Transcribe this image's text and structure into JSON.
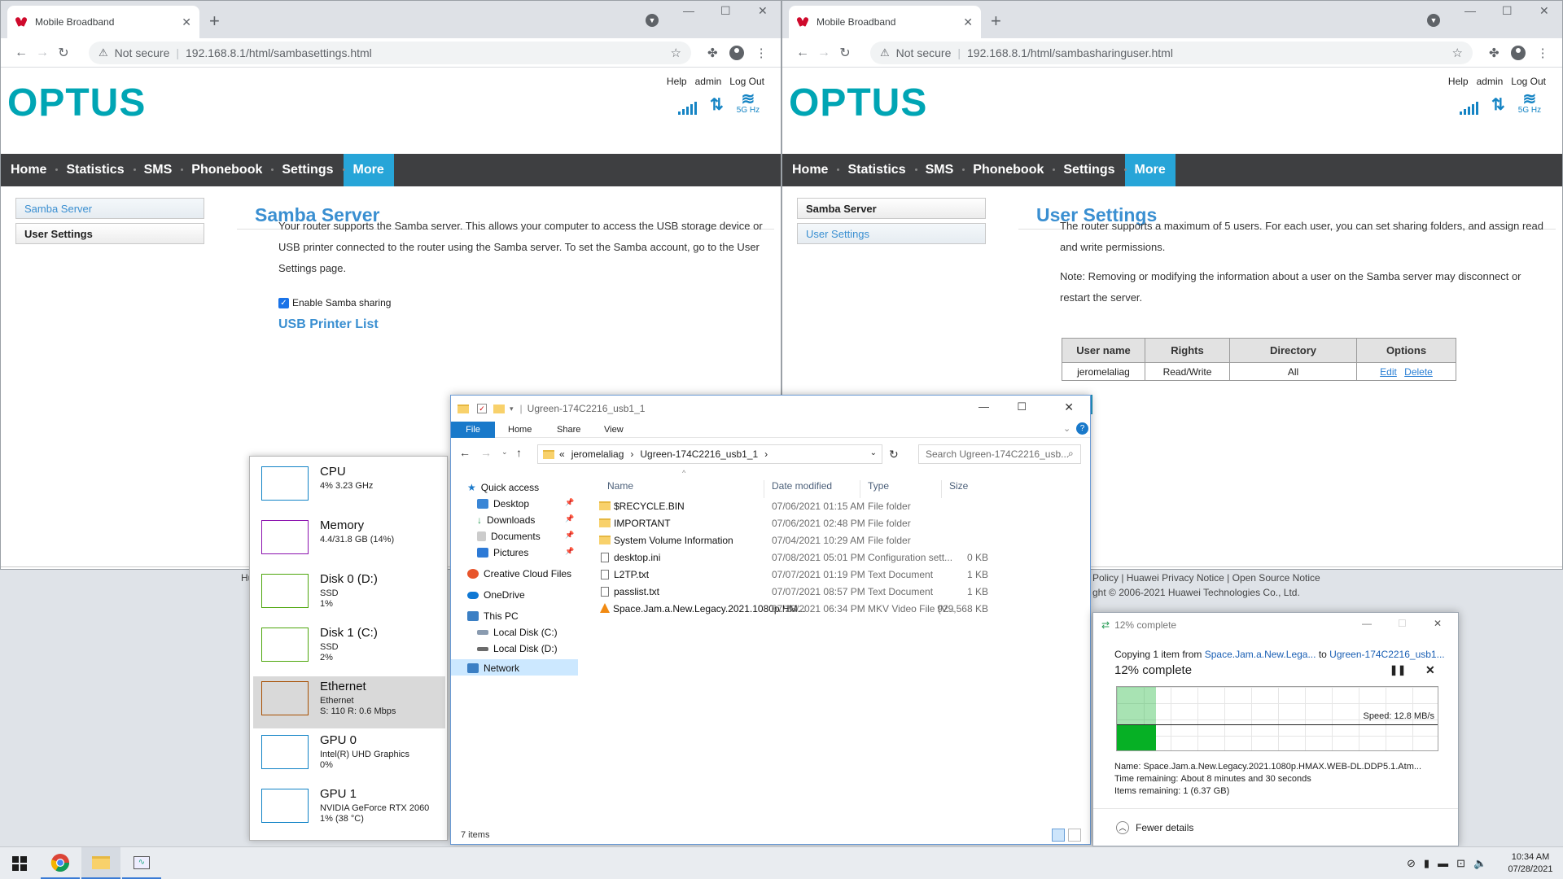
{
  "left_browser": {
    "tab_title": "Mobile Broadband",
    "security": "Not secure",
    "url": "192.168.8.1/html/sambasettings.html",
    "top_links": [
      "Help",
      "admin",
      "Log Out"
    ],
    "logo": "OPTUS",
    "wifi_label": "5G Hz",
    "nav": [
      "Home",
      "Statistics",
      "SMS",
      "Phonebook",
      "Settings",
      "More"
    ],
    "active_nav": "More",
    "sidebar": [
      "Samba Server",
      "User Settings"
    ],
    "page_title": "Samba Server",
    "description": "Your router supports the Samba server. This allows your computer to access the USB storage device or USB printer connected to the router using the Samba server. To set the Samba account, go to the User Settings page.",
    "checkbox_label": "Enable Samba sharing",
    "checkbox_checked": true,
    "link": "USB Printer List",
    "footer_fragment": "Hu"
  },
  "right_browser": {
    "tab_title": "Mobile Broadband",
    "security": "Not secure",
    "url": "192.168.8.1/html/sambasharinguser.html",
    "top_links": [
      "Help",
      "admin",
      "Log Out"
    ],
    "logo": "OPTUS",
    "wifi_label": "5G Hz",
    "nav": [
      "Home",
      "Statistics",
      "SMS",
      "Phonebook",
      "Settings",
      "More"
    ],
    "sidebar": [
      "Samba Server",
      "User Settings"
    ],
    "page_title": "User Settings",
    "paragraph1": "The router supports a maximum of 5 users. For each user, you can set sharing folders, and assign read and write permissions.",
    "paragraph2": "Note: Removing or modifying the information about a user on the Samba server may disconnect or restart the server.",
    "table": {
      "headers": [
        "User name",
        "Rights",
        "Directory",
        "Options"
      ],
      "rows": [
        {
          "user": "jeromelaliag",
          "rights": "Read/Write",
          "directory": "All",
          "edit": "Edit",
          "delete": "Delete"
        }
      ]
    },
    "footer_links": "Policy | Huawei Privacy Notice | Open Source Notice",
    "copyright": "ght © 2006-2021 Huawei Technologies Co., Ltd."
  },
  "task_manager": {
    "items": [
      {
        "name": "CPU",
        "sub1": "4% 3.23 GHz",
        "sub2": "",
        "color": "#1183c6"
      },
      {
        "name": "Memory",
        "sub1": "4.4/31.8 GB (14%)",
        "sub2": "",
        "color": "#8b12ae"
      },
      {
        "name": "Disk 0 (D:)",
        "sub1": "SSD",
        "sub2": "1%",
        "color": "#4da60c"
      },
      {
        "name": "Disk 1 (C:)",
        "sub1": "SSD",
        "sub2": "2%",
        "color": "#4da60c"
      },
      {
        "name": "Ethernet",
        "sub1": "Ethernet",
        "sub2": "S: 110 R: 0.6 Mbps",
        "color": "#a74f01"
      },
      {
        "name": "GPU 0",
        "sub1": "Intel(R) UHD Graphics",
        "sub2": "0%",
        "color": "#1183c6"
      },
      {
        "name": "GPU 1",
        "sub1": "NVIDIA GeForce RTX 2060",
        "sub2": "1% (38 °C)",
        "color": "#1183c6"
      }
    ],
    "selected": "Ethernet"
  },
  "explorer": {
    "title": "Ugreen-174C2216_usb1_1",
    "ribbon": [
      "File",
      "Home",
      "Share",
      "View"
    ],
    "path": [
      "«",
      "jeromelaliag",
      "›",
      "Ugreen-174C2216_usb1_1",
      "›"
    ],
    "search_placeholder": "Search Ugreen-174C2216_usb...",
    "nav": {
      "quick_access": "Quick access",
      "desktop": "Desktop",
      "downloads": "Downloads",
      "documents": "Documents",
      "pictures": "Pictures",
      "ccf": "Creative Cloud Files",
      "onedrive": "OneDrive",
      "thispc": "This PC",
      "localc": "Local Disk (C:)",
      "locald": "Local Disk (D:)",
      "network": "Network"
    },
    "columns": [
      "Name",
      "Date modified",
      "Type",
      "Size"
    ],
    "files": [
      {
        "name": "$RECYCLE.BIN",
        "date": "07/06/2021 01:15 AM",
        "type": "File folder",
        "size": "",
        "icon": "folder"
      },
      {
        "name": "IMPORTANT",
        "date": "07/06/2021 02:48 PM",
        "type": "File folder",
        "size": "",
        "icon": "folder"
      },
      {
        "name": "System Volume Information",
        "date": "07/04/2021 10:29 AM",
        "type": "File folder",
        "size": "",
        "icon": "folder"
      },
      {
        "name": "desktop.ini",
        "date": "07/08/2021 05:01 PM",
        "type": "Configuration sett...",
        "size": "0 KB",
        "icon": "doc"
      },
      {
        "name": "L2TP.txt",
        "date": "07/07/2021 01:19 PM",
        "type": "Text Document",
        "size": "1 KB",
        "icon": "doc"
      },
      {
        "name": "passlist.txt",
        "date": "07/07/2021 08:57 PM",
        "type": "Text Document",
        "size": "1 KB",
        "icon": "doc"
      },
      {
        "name": "Space.Jam.a.New.Legacy.2021.1080p.HM...",
        "date": "07/28/2021 06:34 PM",
        "type": "MKV Video File (V...",
        "size": "929,568 KB",
        "icon": "vlc"
      }
    ],
    "status": "7 items"
  },
  "copy_dialog": {
    "title": "12% complete",
    "copying_prefix": "Copying 1 item from",
    "from": "Space.Jam.a.New.Lega...",
    "to_word": "to",
    "to": "Ugreen-174C2216_usb1...",
    "percent_text": "12% complete",
    "progress": 0.12,
    "speed": "Speed: 12.8 MB/s",
    "name_label": "Name:",
    "name": "Space.Jam.a.New.Legacy.2021.1080p.HMAX.WEB-DL.DDP5.1.Atm...",
    "time_label": "Time remaining:",
    "time": "About 8 minutes and 30 seconds",
    "items_label": "Items remaining:",
    "items": "1 (6.37 GB)",
    "fewer": "Fewer details"
  },
  "taskbar": {
    "time": "10:34 AM",
    "date": "07/28/2021"
  }
}
